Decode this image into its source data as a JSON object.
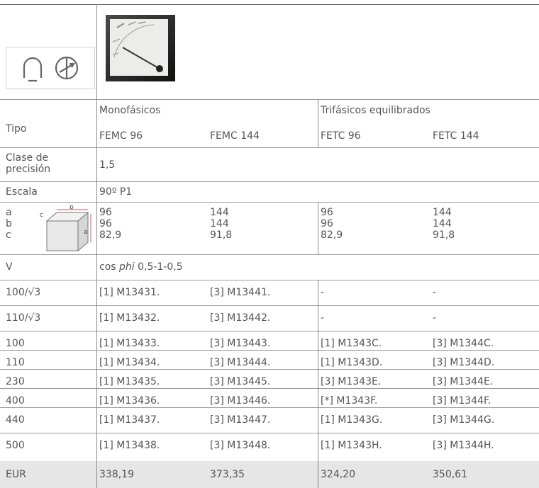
{
  "header": {
    "group_mono": "Monofásicos",
    "group_tri": "Trifásicos equilibrados",
    "tipo_label": "Tipo",
    "models": [
      "FEMC 96",
      "FEMC 144",
      "FETC 96",
      "FETC 144"
    ]
  },
  "specs": {
    "precision_label_line1": "Clase de",
    "precision_label_line2": "precisión",
    "precision_value": "1,5",
    "escala_label": "Escala",
    "escala_value": "90º P1",
    "dim_labels": [
      "a",
      "b",
      "c"
    ],
    "dims_by_col": [
      [
        "96",
        "96",
        "82,9"
      ],
      [
        "144",
        "144",
        "91,8"
      ],
      [
        "96",
        "96",
        "82,9"
      ],
      [
        "144",
        "144",
        "91,8"
      ]
    ],
    "v_label": "V",
    "v_value_prefix": "cos ",
    "v_value_italic": "phi",
    "v_value_suffix": " 0,5-1-0,5"
  },
  "rows": [
    {
      "label": "100/√3",
      "cells": [
        "[1] M13431.",
        "[3] M13441.",
        "-",
        "-"
      ]
    },
    {
      "label": "110/√3",
      "cells": [
        "[1] M13432.",
        "[3] M13442.",
        "-",
        "-"
      ]
    },
    {
      "label": "100",
      "cells": [
        "[1] M13433.",
        "[3] M13443.",
        "[1] M1343C.",
        "[3] M1344C."
      ]
    },
    {
      "label": "110",
      "cells": [
        "[1] M13434.",
        "[3] M13444.",
        "[1] M1343D.",
        "[3] M1344D."
      ]
    },
    {
      "label": "230",
      "cells": [
        "[1] M13435.",
        "[3] M13445.",
        "[3] M1343E.",
        "[3] M1344E."
      ]
    },
    {
      "label": "400",
      "cells": [
        "[1] M13436.",
        "[3] M13446.",
        "[*] M1343F.",
        "[3] M1344F."
      ]
    },
    {
      "label": "440",
      "cells": [
        "[1] M13437.",
        "[3] M13447.",
        "[1] M1343G.",
        "[3] M1344G."
      ]
    },
    {
      "label": "500",
      "cells": [
        "[1] M13438.",
        "[3] M13448.",
        "[1] M1343H.",
        "[3] M1344H."
      ]
    }
  ],
  "footer": {
    "currency": "EUR",
    "prices": [
      "338,19",
      "373,35",
      "324,20",
      "350,61"
    ]
  },
  "icons": {
    "coil": "coil-symbol-icon",
    "meter_symbol": "circle-arrow-symbol-icon",
    "photo": "analog-meter-photo",
    "dims": "box-dimensions-diagram"
  }
}
